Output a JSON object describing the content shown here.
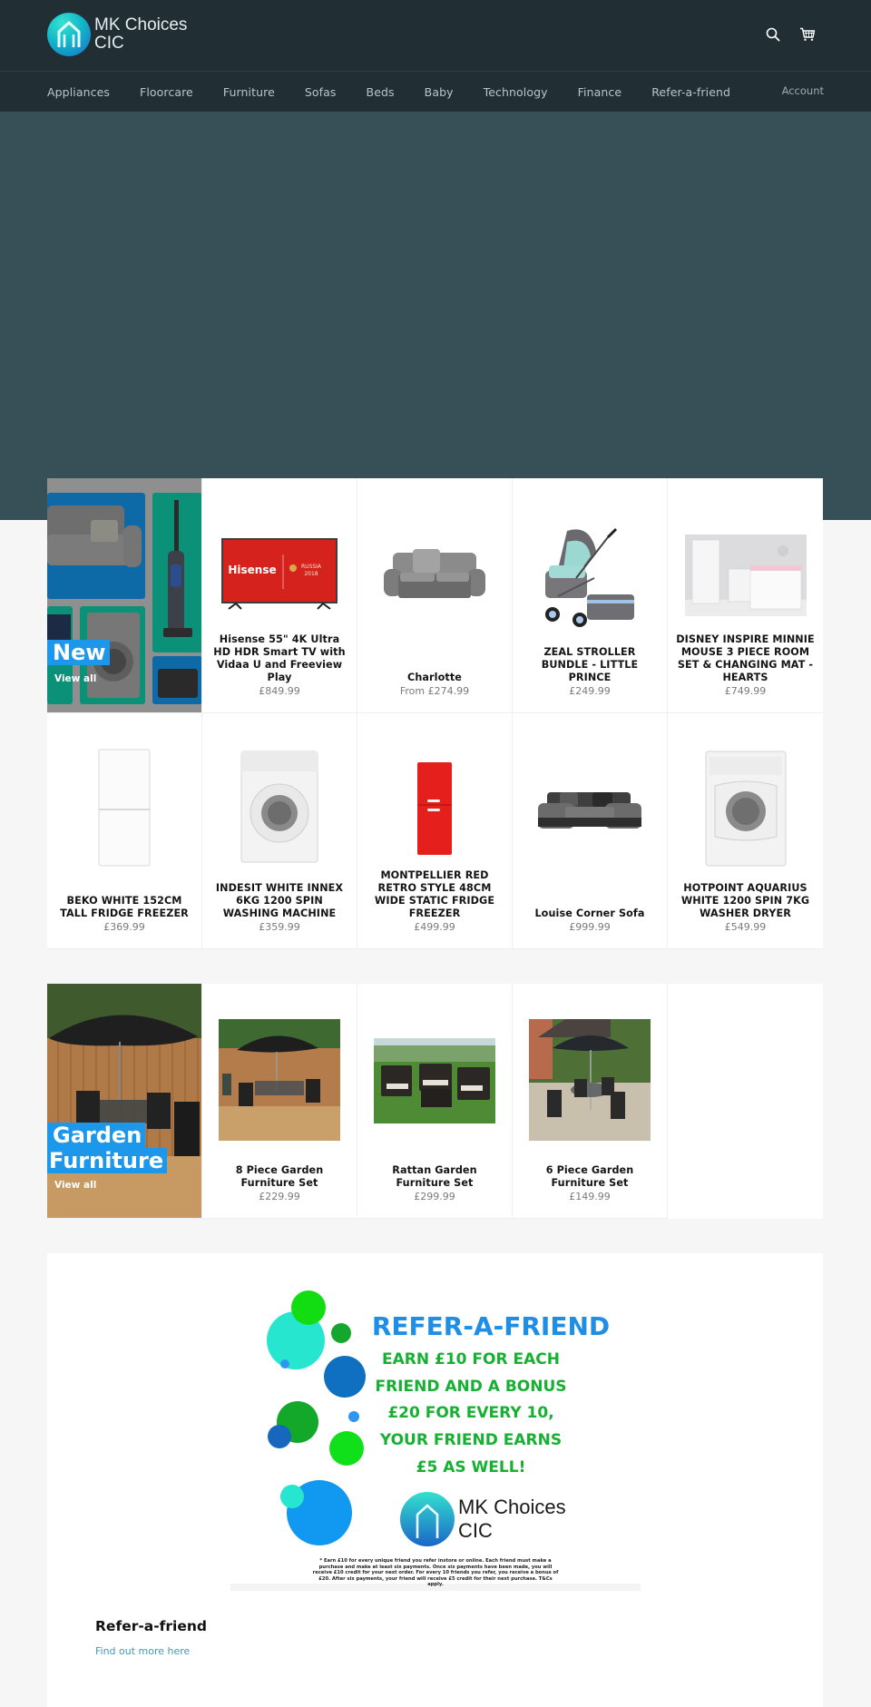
{
  "header": {
    "logo_line1": "MK Choices",
    "logo_line2": "CIC",
    "icons": [
      "search-icon",
      "cart-icon"
    ]
  },
  "nav": {
    "items": [
      {
        "label": "Appliances"
      },
      {
        "label": "Floorcare"
      },
      {
        "label": "Furniture"
      },
      {
        "label": "Sofas"
      },
      {
        "label": "Beds"
      },
      {
        "label": "Baby"
      },
      {
        "label": "Technology"
      },
      {
        "label": "Finance"
      },
      {
        "label": "Refer-a-friend"
      }
    ],
    "account": "Account"
  },
  "colors": {
    "header_bg": "#212f35",
    "hero_bg": "#374f56",
    "accent_blue": "#1d97e9",
    "link": "#3a9bc2"
  },
  "collections": [
    {
      "title": "New",
      "view_all": "View all",
      "products": [
        {
          "title": "Hisense 55\" 4K Ultra HD HDR Smart TV with Vidaa U and Freeview Play",
          "price": "£849.99"
        },
        {
          "title": "Charlotte",
          "price": "From £274.99"
        },
        {
          "title": "ZEAL STROLLER BUNDLE - LITTLE PRINCE",
          "price": "£249.99"
        },
        {
          "title": "DISNEY INSPIRE MINNIE MOUSE 3 PIECE ROOM SET & CHANGING MAT - HEARTS",
          "price": "£749.99"
        },
        {
          "title": "BEKO WHITE 152CM TALL FRIDGE FREEZER",
          "price": "£369.99"
        },
        {
          "title": "INDESIT WHITE INNEX 6KG 1200 SPIN WASHING MACHINE",
          "price": "£359.99"
        },
        {
          "title": "MONTPELLIER RED RETRO STYLE 48CM WIDE STATIC FRIDGE FREEZER",
          "price": "£499.99"
        },
        {
          "title": "Louise Corner Sofa",
          "price": "£999.99"
        },
        {
          "title": "HOTPOINT AQUARIUS WHITE 1200 SPIN 7KG WASHER DRYER",
          "price": "£549.99"
        }
      ]
    },
    {
      "title_line1": "Garden",
      "title_line2": "Furniture",
      "view_all": "View all",
      "products": [
        {
          "title": "8 Piece Garden Furniture Set",
          "price": "£229.99"
        },
        {
          "title": "Rattan Garden Furniture Set",
          "price": "£299.99"
        },
        {
          "title": "6 Piece Garden Furniture Set",
          "price": "£149.99"
        }
      ]
    }
  ],
  "refer": {
    "banner": {
      "headline": "REFER-A-FRIEND",
      "lines": [
        "EARN £10 FOR EACH",
        "FRIEND AND A BONUS",
        "£20 FOR EVERY 10,",
        "YOUR FRIEND EARNS",
        "£5 AS WELL!"
      ],
      "logo_line1": "MK Choices",
      "logo_line2": "CIC",
      "fineprint": "* Earn £10 for every unique friend you refer instore or online. Each friend must make a purchase and make at least six payments. Once six payments have been made, you will receive £10 credit for your next order. For every 10 friends you refer, you receive a bonus of £20. After six payments, your friend will receive £5 credit for their next purchase. T&Cs apply."
    },
    "heading": "Refer-a-friend",
    "link": "Find out more here"
  }
}
